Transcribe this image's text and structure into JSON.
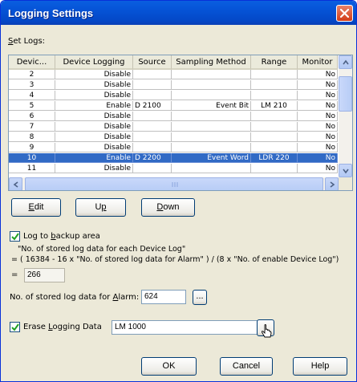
{
  "window": {
    "title": "Logging Settings"
  },
  "set_logs_label": "Set Logs:",
  "columns": [
    "Devic...",
    "Device Logging",
    "Source",
    "Sampling Method",
    "Range",
    "Monitor"
  ],
  "rows": [
    {
      "num": "2",
      "logging": "Disable",
      "source": "",
      "method": "",
      "range": "",
      "monitor": "No"
    },
    {
      "num": "3",
      "logging": "Disable",
      "source": "",
      "method": "",
      "range": "",
      "monitor": "No"
    },
    {
      "num": "4",
      "logging": "Disable",
      "source": "",
      "method": "",
      "range": "",
      "monitor": "No"
    },
    {
      "num": "5",
      "logging": "Enable",
      "source": "D 2100",
      "method": "Event Bit",
      "range": "LM 210",
      "monitor": "No"
    },
    {
      "num": "6",
      "logging": "Disable",
      "source": "",
      "method": "",
      "range": "",
      "monitor": "No"
    },
    {
      "num": "7",
      "logging": "Disable",
      "source": "",
      "method": "",
      "range": "",
      "monitor": "No"
    },
    {
      "num": "8",
      "logging": "Disable",
      "source": "",
      "method": "",
      "range": "",
      "monitor": "No"
    },
    {
      "num": "9",
      "logging": "Disable",
      "source": "",
      "method": "",
      "range": "",
      "monitor": "No"
    },
    {
      "num": "10",
      "logging": "Enable",
      "source": "D 2200",
      "method": "Event Word",
      "range": "LDR 220",
      "monitor": "No"
    },
    {
      "num": "11",
      "logging": "Disable",
      "source": "",
      "method": "",
      "range": "",
      "monitor": "No"
    }
  ],
  "selected_row": "10",
  "buttons": {
    "edit": "Edit",
    "up": "Up",
    "down": "Down",
    "ok": "OK",
    "cancel": "Cancel",
    "help": "Help",
    "browse": "..."
  },
  "log_backup": {
    "label": "Log to backup area",
    "checked": true
  },
  "formula": {
    "line1": "\"No. of stored log data for each Device Log\"",
    "line2": "= ( 16384 - 16 x \"No. of stored log data for Alarm\" ) / (8 x \"No. of enable Device Log\")",
    "equals": "=",
    "value": "266"
  },
  "alarm": {
    "label": "No. of stored log data for Alarm:",
    "value": "624"
  },
  "erase": {
    "label": "Erase Logging Data",
    "checked": true,
    "value": "LM 1000"
  }
}
